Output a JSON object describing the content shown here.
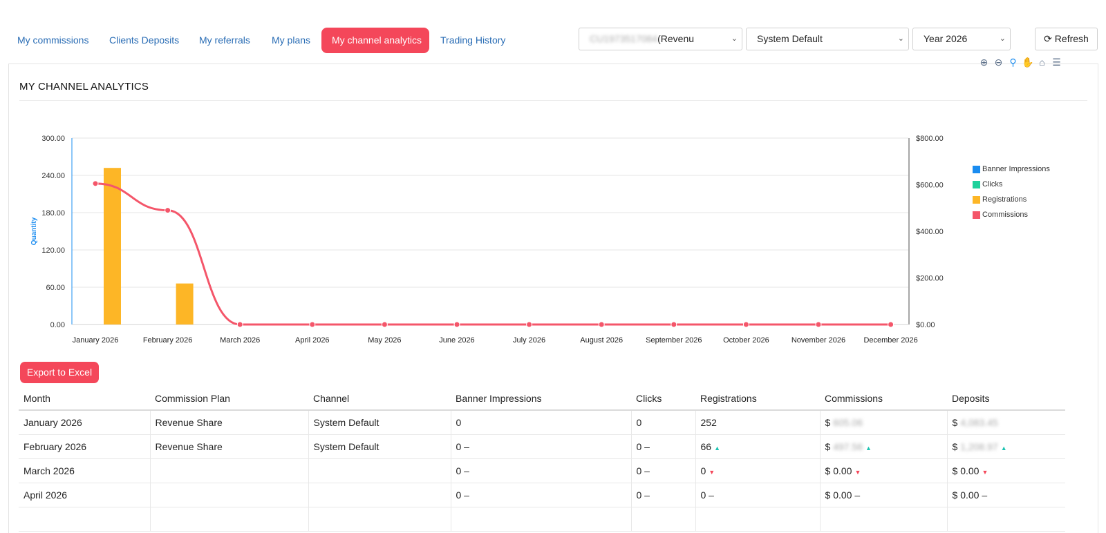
{
  "tabs": [
    {
      "label": "My commissions",
      "active": false
    },
    {
      "label": "Clients Deposits",
      "active": false
    },
    {
      "label": "My referrals",
      "active": false
    },
    {
      "label": "My plans",
      "active": false
    },
    {
      "label": "My channel analytics",
      "active": true
    },
    {
      "label": "Trading History",
      "active": false
    }
  ],
  "filters": {
    "account_select_visible": "(Revenu",
    "channel_select": "System Default",
    "year_select": "Year 2026",
    "refresh_label": "Refresh"
  },
  "panel": {
    "title": "MY CHANNEL ANALYTICS"
  },
  "toolbar_icons": [
    "zoom-in-icon",
    "zoom-out-icon",
    "zoom-selection-icon",
    "pan-hand-icon",
    "home-reset-icon",
    "menu-icon"
  ],
  "chart_data": {
    "type": "bar+line",
    "categories": [
      "January 2026",
      "February 2026",
      "March 2026",
      "April 2026",
      "May 2026",
      "June 2026",
      "July 2026",
      "August 2026",
      "September 2026",
      "October 2026",
      "November 2026",
      "December 2026"
    ],
    "y_left_label": "Quantity",
    "y_left_ticks": [
      "300.00",
      "240.00",
      "180.00",
      "120.00",
      "60.00",
      "0.00"
    ],
    "y_left_range": [
      0,
      300
    ],
    "y_right_ticks": [
      "$800.00",
      "$600.00",
      "$400.00",
      "$200.00",
      "$0.00"
    ],
    "y_right_range": [
      0,
      800
    ],
    "series": [
      {
        "name": "Banner Impressions",
        "type": "bar",
        "axis": "left",
        "color": "#1a8cf0",
        "values": [
          0,
          0,
          0,
          0,
          0,
          0,
          0,
          0,
          0,
          0,
          0,
          0
        ]
      },
      {
        "name": "Clicks",
        "type": "bar",
        "axis": "left",
        "color": "#1ed19c",
        "values": [
          0,
          0,
          0,
          0,
          0,
          0,
          0,
          0,
          0,
          0,
          0,
          0
        ]
      },
      {
        "name": "Registrations",
        "type": "bar",
        "axis": "left",
        "color": "#fdb626",
        "values": [
          252,
          66,
          0,
          0,
          0,
          0,
          0,
          0,
          0,
          0,
          0,
          0
        ]
      },
      {
        "name": "Commissions",
        "type": "line",
        "axis": "right",
        "color": "#f4566a",
        "values": [
          605,
          490,
          0,
          0,
          0,
          0,
          0,
          0,
          0,
          0,
          0,
          0
        ]
      }
    ],
    "legend_position": "right",
    "grid": true
  },
  "export_label": "Export to Excel",
  "table": {
    "headers": [
      "Month",
      "Commission Plan",
      "Channel",
      "Banner Impressions",
      "Clicks",
      "Registrations",
      "Commissions",
      "Deposits"
    ],
    "rows": [
      {
        "month": "January 2026",
        "plan": "Revenue Share",
        "channel": "System Default",
        "banner": "0",
        "clicks": "0",
        "registrations": "252",
        "reg_trend": "",
        "commissions_prefix": "$",
        "commissions_value": "605.06",
        "commissions_blurred": true,
        "comm_trend": "",
        "deposits_prefix": "$",
        "deposits_value": "4,083.45",
        "deposits_blurred": true,
        "dep_trend": ""
      },
      {
        "month": "February 2026",
        "plan": "Revenue Share",
        "channel": "System Default",
        "banner": "0 –",
        "clicks": "0 –",
        "registrations": "66",
        "reg_trend": "up",
        "commissions_prefix": "$",
        "commissions_value": "497.56",
        "commissions_blurred": true,
        "comm_trend": "up",
        "deposits_prefix": "$",
        "deposits_value": "1,208.97",
        "deposits_blurred": true,
        "dep_trend": "up"
      },
      {
        "month": "March 2026",
        "plan": "",
        "channel": "",
        "banner": "0 –",
        "clicks": "0 –",
        "registrations": "0",
        "reg_trend": "down",
        "commissions_prefix": "$",
        "commissions_value": "0.00",
        "commissions_blurred": false,
        "comm_trend": "down",
        "deposits_prefix": "$",
        "deposits_value": "0.00",
        "deposits_blurred": false,
        "dep_trend": "down"
      },
      {
        "month": "April 2026",
        "plan": "",
        "channel": "",
        "banner": "0 –",
        "clicks": "0 –",
        "registrations": "0 –",
        "reg_trend": "",
        "commissions_prefix": "$",
        "commissions_value": "0.00 –",
        "commissions_blurred": false,
        "comm_trend": "",
        "deposits_prefix": "$",
        "deposits_value": "0.00 –",
        "deposits_blurred": false,
        "dep_trend": ""
      },
      {
        "month": "",
        "plan": "",
        "channel": "",
        "banner": "",
        "clicks": "",
        "registrations": "",
        "reg_trend": "",
        "commissions_prefix": "",
        "commissions_value": "",
        "commissions_blurred": false,
        "comm_trend": "",
        "deposits_prefix": "",
        "deposits_value": "",
        "deposits_blurred": false,
        "dep_trend": ""
      }
    ]
  }
}
